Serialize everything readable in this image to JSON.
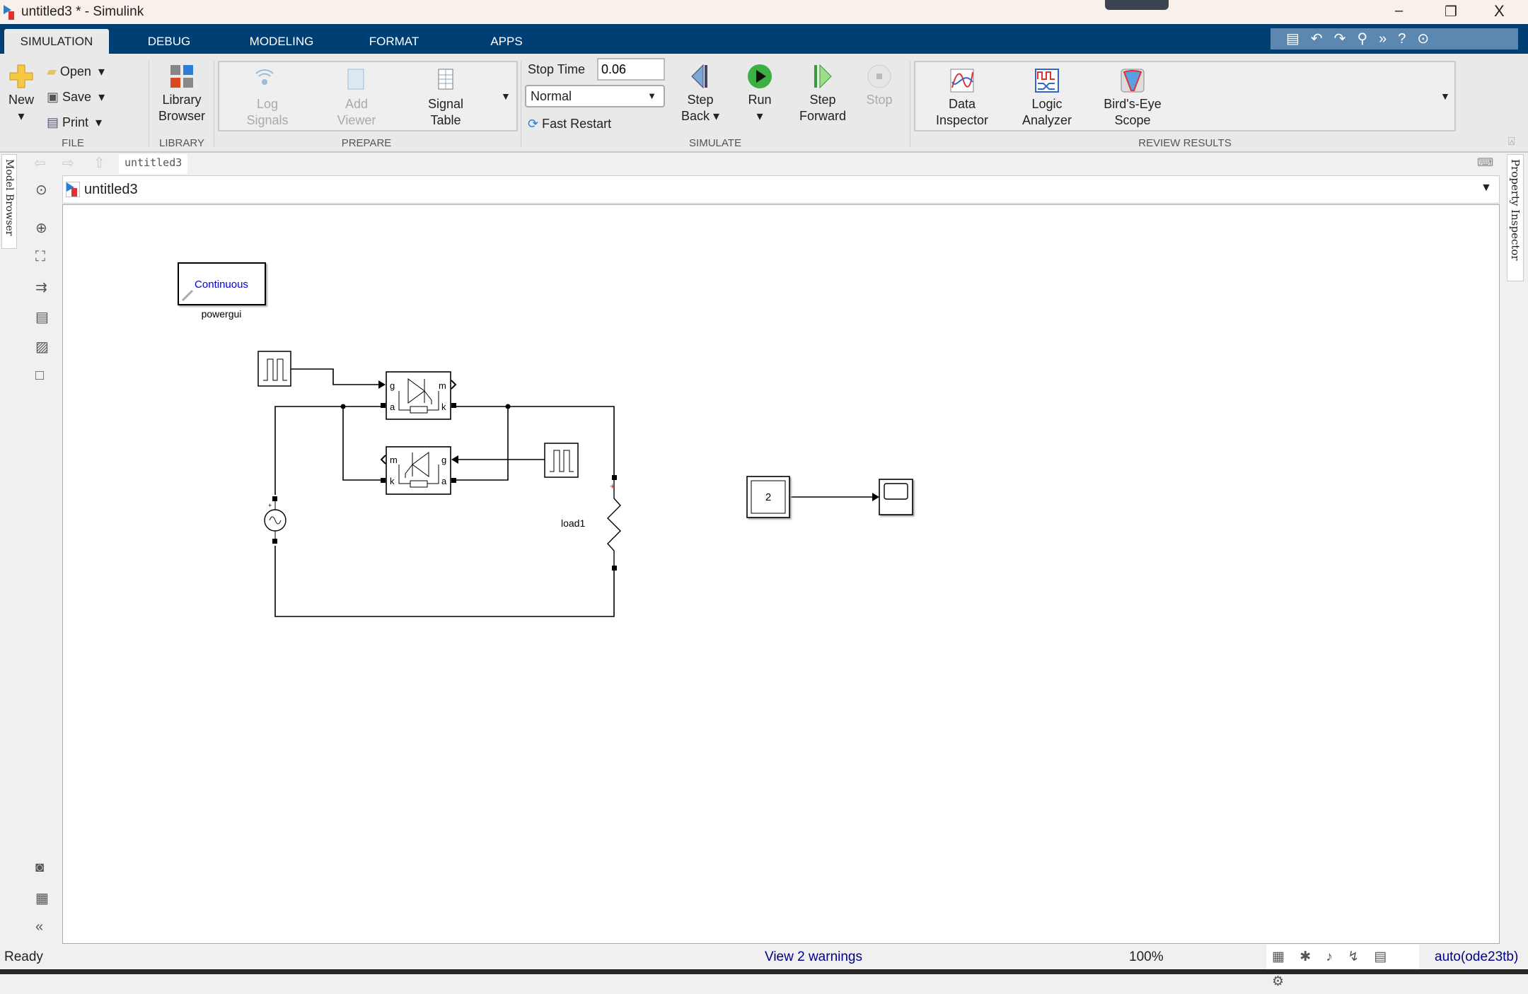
{
  "window": {
    "title": "untitled3 * - Simulink",
    "minimize": "–",
    "restore": "❐",
    "close": "X"
  },
  "tabs": [
    {
      "label": "SIMULATION",
      "active": true
    },
    {
      "label": "DEBUG"
    },
    {
      "label": "MODELING"
    },
    {
      "label": "FORMAT"
    },
    {
      "label": "APPS"
    }
  ],
  "ribbon": {
    "file": {
      "section": "FILE",
      "new": "New",
      "open": "Open",
      "save": "Save",
      "print": "Print"
    },
    "library": {
      "section": "LIBRARY",
      "browser_l1": "Library",
      "browser_l2": "Browser"
    },
    "prepare": {
      "section": "PREPARE",
      "log_l1": "Log",
      "log_l2": "Signals",
      "viewer_l1": "Add",
      "viewer_l2": "Viewer",
      "table_l1": "Signal",
      "table_l2": "Table"
    },
    "simulate": {
      "section": "SIMULATE",
      "stop_time_label": "Stop Time",
      "stop_time": "0.06",
      "mode": "Normal",
      "fast_restart": "Fast Restart",
      "step_back_l1": "Step",
      "step_back_l2": "Back",
      "run": "Run",
      "step_fwd_l1": "Step",
      "step_fwd_l2": "Forward",
      "stop": "Stop"
    },
    "review": {
      "section": "REVIEW RESULTS",
      "di_l1": "Data",
      "di_l2": "Inspector",
      "la_l1": "Logic",
      "la_l2": "Analyzer",
      "be_l1": "Bird's-Eye",
      "be_l2": "Scope"
    }
  },
  "breadcrumb": {
    "tab": "untitled3"
  },
  "address": {
    "model": "untitled3"
  },
  "side_tabs": {
    "left": "Model Browser",
    "right": "Property Inspector"
  },
  "diagram": {
    "powergui_text": "Continuous",
    "powergui_label": "powergui",
    "thy1_ports": {
      "g": "g",
      "m": "m",
      "a": "a",
      "k": "k"
    },
    "thy2_ports": {
      "m": "m",
      "g": "g",
      "k": "k",
      "a": "a"
    },
    "load_label": "load1",
    "gain_value": "2",
    "plus": "+"
  },
  "status": {
    "left": "Ready",
    "warnings": "View 2 warnings",
    "zoom": "100%",
    "solver": "auto(ode23tb)"
  },
  "colors": {
    "tabbar": "#003f74",
    "link": "#0000cc",
    "run_green": "#3cb043"
  }
}
